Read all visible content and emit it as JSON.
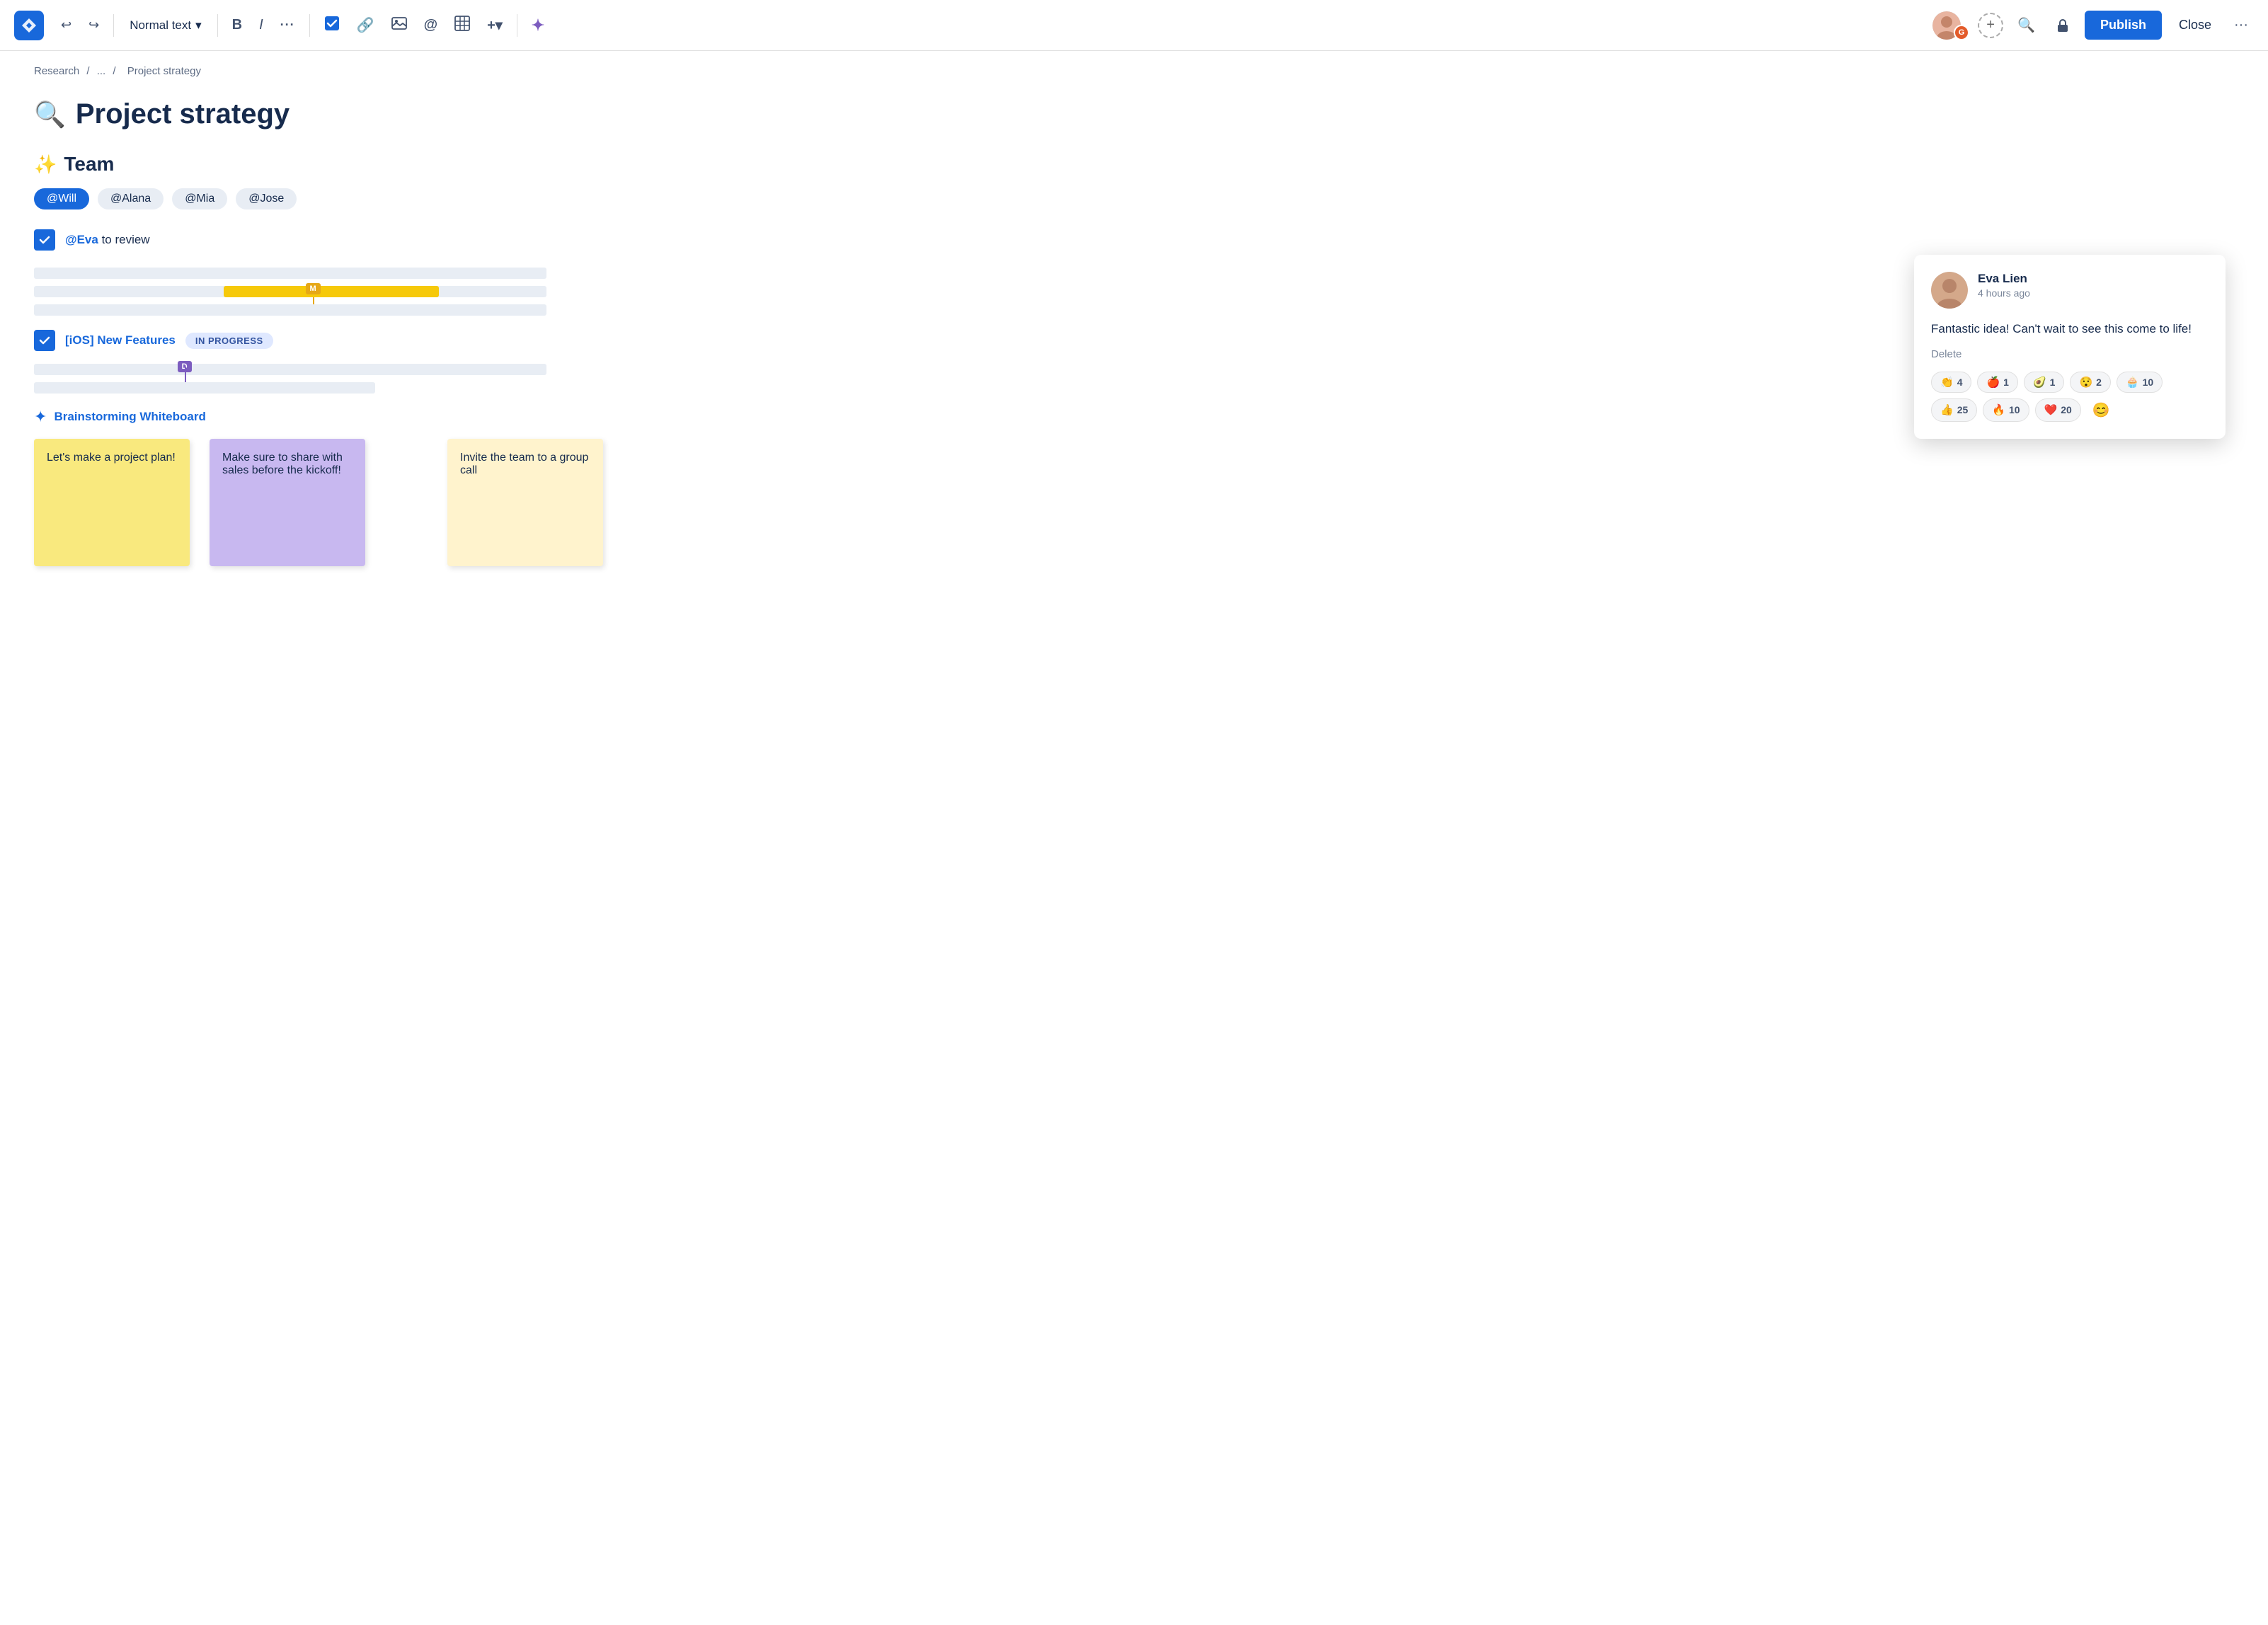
{
  "toolbar": {
    "undo_icon": "↩",
    "redo_icon": "↪",
    "normal_text": "Normal text",
    "dropdown_icon": "▾",
    "bold": "B",
    "italic": "I",
    "more": "···",
    "check_icon": "✓",
    "link_icon": "🔗",
    "image_icon": "🖼",
    "at_icon": "@",
    "table_icon": "⊞",
    "plus_icon": "+▾",
    "ai_icon": "✦",
    "search_icon": "🔍",
    "lock_icon": "🔒",
    "publish_label": "Publish",
    "close_label": "Close",
    "more_options": "···"
  },
  "breadcrumb": {
    "items": [
      "Research",
      "...",
      "Project strategy"
    ]
  },
  "page": {
    "title": "Project strategy",
    "title_icon": "🔍"
  },
  "team_section": {
    "heading": "Team",
    "sparkle": "✨",
    "mentions": [
      {
        "label": "@Will",
        "active": true
      },
      {
        "label": "@Alana",
        "active": false
      },
      {
        "label": "@Mia",
        "active": false
      },
      {
        "label": "@Jose",
        "active": false
      }
    ]
  },
  "task": {
    "mention": "@Eva",
    "text": "to review"
  },
  "gantt": {
    "marker_m": "M",
    "marker_d": "D",
    "rows": [
      {
        "full": true,
        "bar": null
      },
      {
        "full": false,
        "bar": {
          "start": "37%",
          "width": "40%",
          "color": "yellow"
        }
      },
      {
        "full": false,
        "bar": null
      }
    ]
  },
  "feature_task": {
    "label": "[iOS] New Features",
    "status": "IN PROGRESS"
  },
  "whiteboard": {
    "icon": "✦",
    "title": "Brainstorming Whiteboard",
    "stickies": [
      {
        "text": "Let's make a project plan!",
        "color": "yellow"
      },
      {
        "text": "Make sure to share with sales before the kickoff!",
        "color": "purple"
      },
      {
        "text": "Invite the team to a group call",
        "color": "yellow-light"
      }
    ]
  },
  "comment": {
    "author": "Eva Lien",
    "time": "4 hours ago",
    "body": "Fantastic idea! Can't wait to see this come to life!",
    "delete_label": "Delete",
    "reactions": [
      {
        "emoji": "👏",
        "count": 4
      },
      {
        "emoji": "🍎",
        "count": 1
      },
      {
        "emoji": "🥑",
        "count": 1
      },
      {
        "emoji": "😯",
        "count": 2
      },
      {
        "emoji": "🧁",
        "count": 10
      },
      {
        "emoji": "👍",
        "count": 25
      },
      {
        "emoji": "🔥",
        "count": 10
      },
      {
        "emoji": "❤️",
        "count": 20
      }
    ]
  }
}
